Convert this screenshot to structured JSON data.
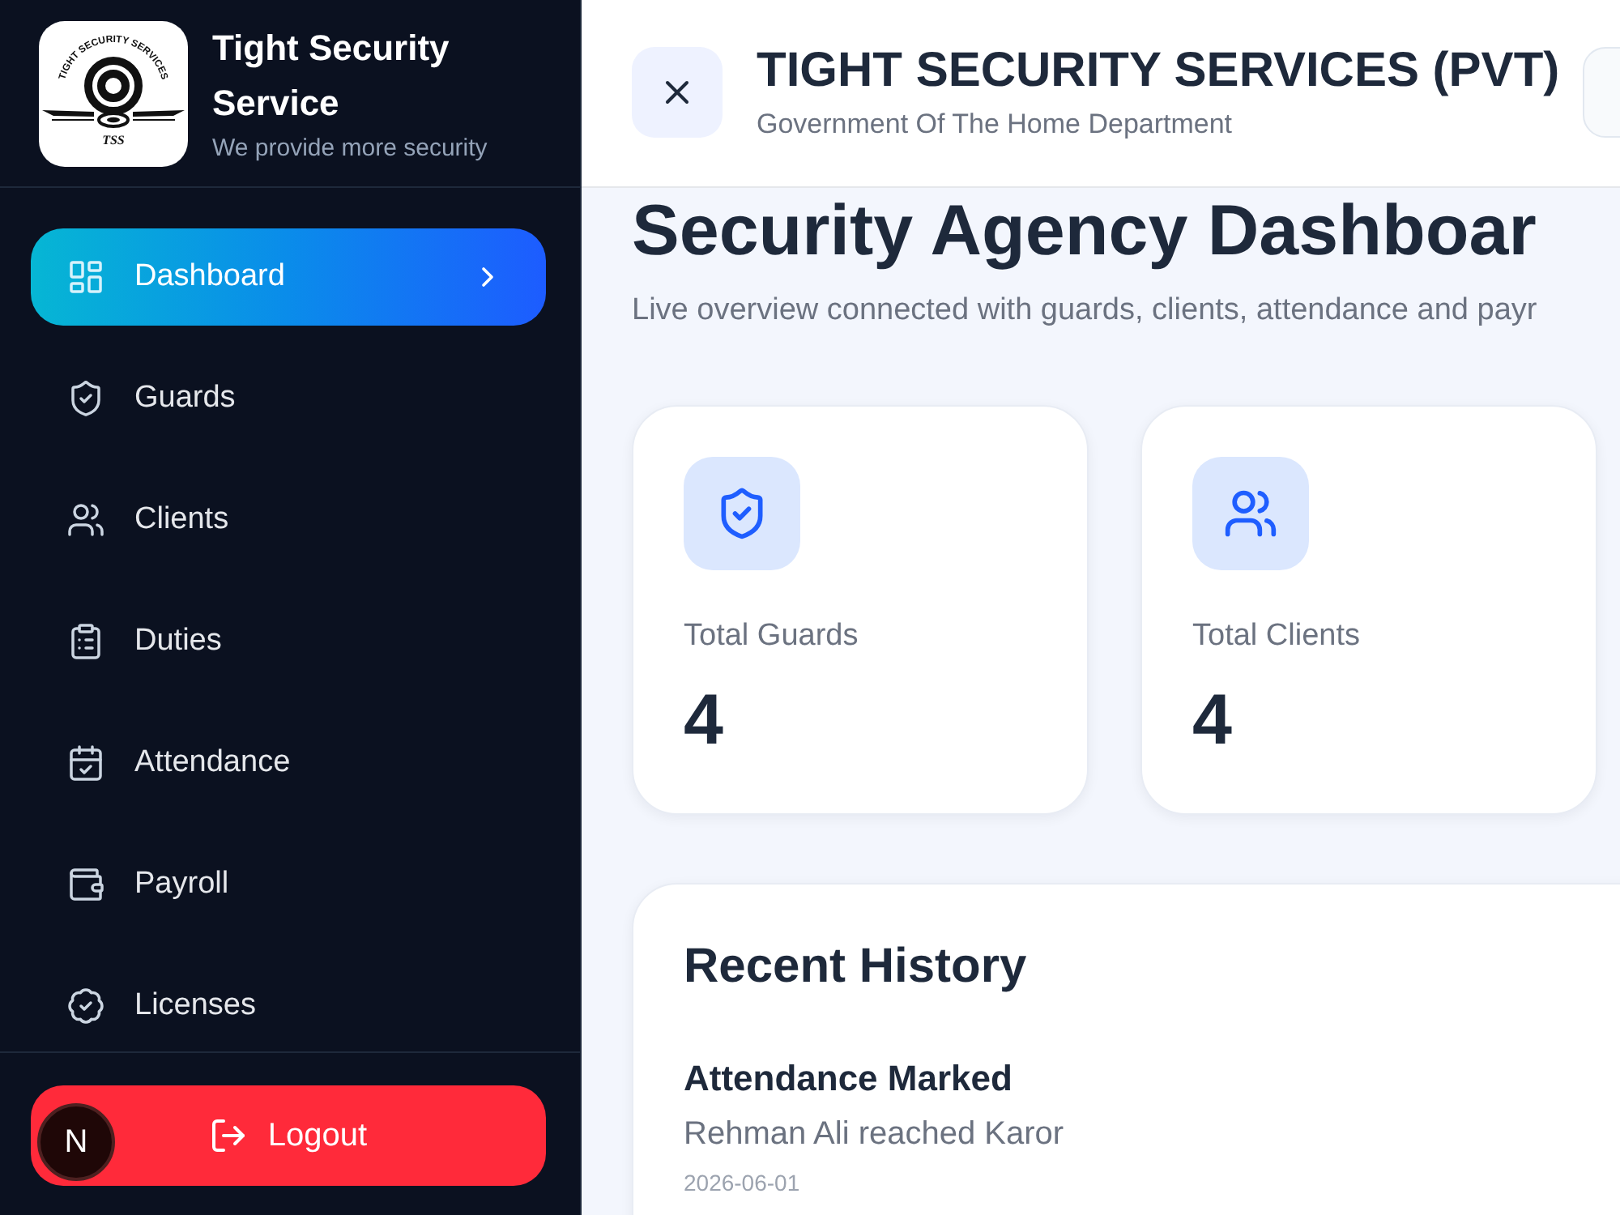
{
  "sidebar": {
    "brand": {
      "logo": {
        "arc_text": "TIGHT SECURITY SERVICES",
        "initials": "TSS"
      },
      "title": "Tight Security Service",
      "tagline": "We provide more security"
    },
    "nav": [
      {
        "label": "Dashboard",
        "selected": true
      },
      {
        "label": "Guards",
        "selected": false
      },
      {
        "label": "Clients",
        "selected": false
      },
      {
        "label": "Duties",
        "selected": false
      },
      {
        "label": "Attendance",
        "selected": false
      },
      {
        "label": "Payroll",
        "selected": false
      },
      {
        "label": "Licenses",
        "selected": false
      }
    ],
    "logout": {
      "label": "Logout"
    }
  },
  "dev_badge": {
    "label": "N"
  },
  "header": {
    "title": "TIGHT SECURITY SERVICES (PVT)",
    "subtitle": "Government Of The Home Department"
  },
  "page": {
    "title": "Security Agency Dashboar",
    "subtitle": "Live overview connected with guards, clients, attendance and payr"
  },
  "stats": [
    {
      "label": "Total Guards",
      "value": "4"
    },
    {
      "label": "Total Clients",
      "value": "4"
    }
  ],
  "recent_history": {
    "title": "Recent History",
    "items": [
      {
        "title": "Attendance Marked",
        "description": "Rehman Ali reached Karor",
        "date": "2026-06-01"
      }
    ]
  }
}
